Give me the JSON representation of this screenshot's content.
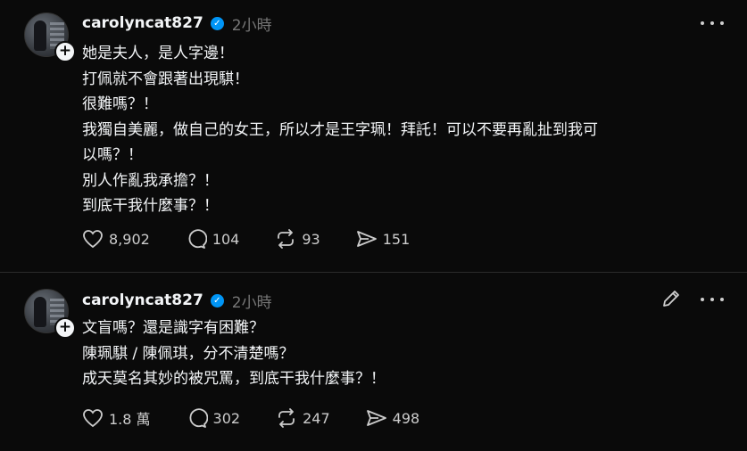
{
  "posts": [
    {
      "username": "carolyncat827",
      "time": "2小時",
      "lines": [
        "她是夫人，是人字邊！",
        "打佩就不會跟著出現騏！",
        "很難嗎？！",
        "我獨自美麗，做自己的女王，所以才是王字珮！拜託！可以不要再亂扯到我可",
        "以嗎？！",
        "別人作亂我承擔？！",
        "到底干我什麼事？！"
      ],
      "likes": "8,902",
      "comments": "104",
      "reposts": "93",
      "shares": "151"
    },
    {
      "username": "carolyncat827",
      "time": "2小時",
      "lines": [
        "文盲嗎？還是識字有困難？",
        "陳珮騏 / 陳佩琪，分不清楚嗎？",
        "成天莫名其妙的被咒罵，到底干我什麼事？！"
      ],
      "likes": "1.8 萬",
      "comments": "302",
      "reposts": "247",
      "shares": "498"
    }
  ],
  "icons": {
    "verified": "verified-badge-icon",
    "like": "heart-icon",
    "comment": "comment-bubble-icon",
    "repost": "repost-icon",
    "share": "send-icon",
    "more": "more-dots-icon",
    "edit": "pencil-icon",
    "follow": "plus-icon"
  },
  "colors": {
    "background": "#0a0a0a",
    "text": "#f3f5f7",
    "muted": "#777777",
    "verified": "#0095f6"
  }
}
